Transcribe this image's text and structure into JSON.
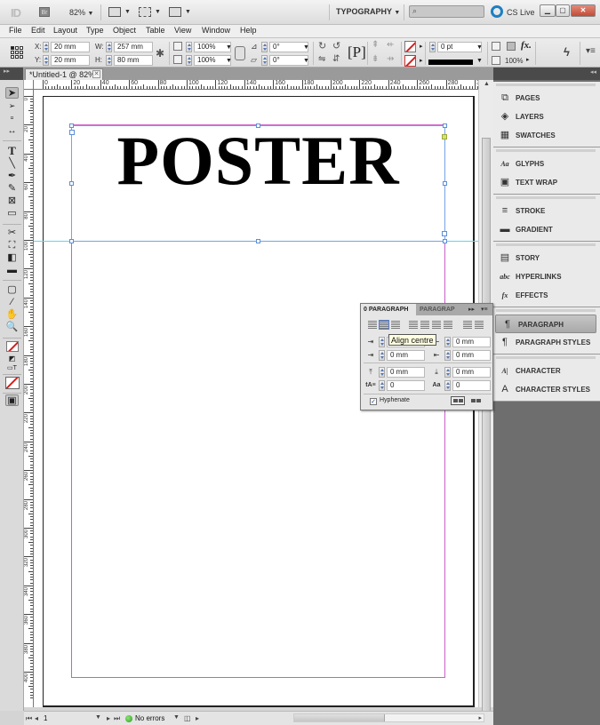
{
  "appbar": {
    "app_logo": "ID",
    "bridge_label": "Br",
    "zoom_level": "82%",
    "workspace": "TYPOGRAPHY",
    "search_placeholder": "",
    "cs_live": "CS Live",
    "window_buttons": [
      "minimize",
      "restore",
      "close"
    ]
  },
  "menubar": {
    "items": [
      "File",
      "Edit",
      "Layout",
      "Type",
      "Object",
      "Table",
      "View",
      "Window",
      "Help"
    ]
  },
  "controlbar": {
    "x_label": "X:",
    "x_value": "20 mm",
    "y_label": "Y:",
    "y_value": "20 mm",
    "w_label": "W:",
    "w_value": "257 mm",
    "h_label": "H:",
    "h_value": "80 mm",
    "scale_x": "100%",
    "scale_y": "100%",
    "rotate": "0°",
    "shear": "0°",
    "stroke_weight": "0 pt",
    "opacity": "100%"
  },
  "document": {
    "tab_title": "*Untitled-1 @ 82%",
    "poster_text": "POSTER",
    "hruler_labels": [
      "0",
      "20",
      "40",
      "60",
      "80",
      "100",
      "120",
      "140",
      "160",
      "180",
      "200",
      "220",
      "240",
      "260",
      "280",
      "3"
    ],
    "vruler_labels": [
      "0",
      "20",
      "40",
      "60",
      "80",
      "100",
      "120",
      "140",
      "160",
      "180",
      "200",
      "220",
      "240",
      "260",
      "280",
      "300",
      "320",
      "340",
      "360",
      "380",
      "400"
    ]
  },
  "statusbar": {
    "page": "1",
    "preflight": "No errors"
  },
  "dock": {
    "groups": [
      {
        "items": [
          {
            "icon": "pages-icon",
            "glyph": "⧉",
            "label": "PAGES"
          },
          {
            "icon": "layers-icon",
            "glyph": "◈",
            "label": "LAYERS"
          },
          {
            "icon": "swatches-icon",
            "glyph": "▦",
            "label": "SWATCHES"
          }
        ]
      },
      {
        "items": [
          {
            "icon": "glyphs-icon",
            "glyph": "Aa",
            "label": "GLYPHS"
          },
          {
            "icon": "text-wrap-icon",
            "glyph": "▣",
            "label": "TEXT WRAP"
          }
        ]
      },
      {
        "items": [
          {
            "icon": "stroke-icon",
            "glyph": "≡",
            "label": "STROKE"
          },
          {
            "icon": "gradient-icon",
            "glyph": "▬",
            "label": "GRADIENT"
          }
        ]
      },
      {
        "items": [
          {
            "icon": "story-icon",
            "glyph": "▤",
            "label": "STORY"
          },
          {
            "icon": "hyperlinks-icon",
            "glyph": "abc",
            "label": "HYPERLINKS"
          },
          {
            "icon": "effects-icon",
            "glyph": "fx",
            "label": "EFFECTS"
          }
        ]
      },
      {
        "items": [
          {
            "icon": "paragraph-icon",
            "glyph": "¶",
            "label": "PARAGRAPH",
            "active": true
          },
          {
            "icon": "paragraph-styles-icon",
            "glyph": "¶",
            "label": "PARAGRAPH STYLES"
          }
        ]
      },
      {
        "items": [
          {
            "icon": "character-icon",
            "glyph": "A|",
            "label": "CHARACTER"
          },
          {
            "icon": "character-styles-icon",
            "glyph": "A",
            "label": "CHARACTER STYLES"
          }
        ]
      }
    ]
  },
  "paragraph_panel": {
    "tab_active": "0 PARAGRAPH",
    "tab_inactive": "PARAGRAP",
    "tooltip": "Align centre",
    "left_indent": "0 mm",
    "right_indent": "0 mm",
    "first_line_indent": "0 mm",
    "last_line_indent": "0 mm",
    "space_before": "0 mm",
    "space_after": "0 mm",
    "drop_cap_lines": "0",
    "drop_cap_chars": "0",
    "hyphenate_label": "Hyphenate",
    "hyphenate_checked": "✓"
  }
}
